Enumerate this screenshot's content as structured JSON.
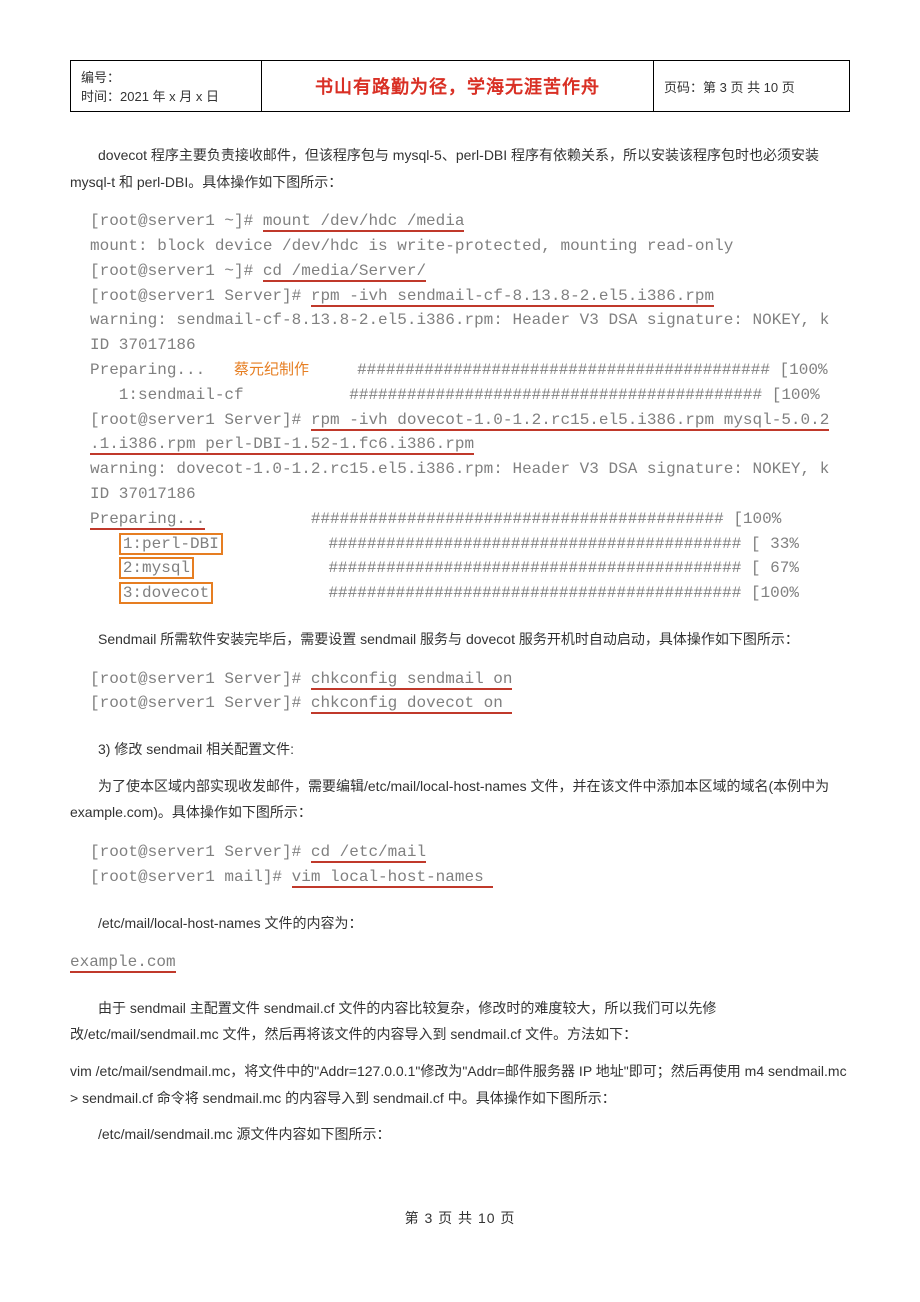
{
  "header": {
    "doc_id_label": "编号：",
    "date_line": "时间：2021 年 x 月 x 日",
    "motto": "书山有路勤为径，学海无涯苦作舟",
    "page_label": "页码：第 3 页 共 10 页"
  },
  "p1": "dovecot 程序主要负责接收邮件，但该程序包与 mysql-5、perl-DBI 程序有依赖关系，所以安装该程序包时也必须安装 mysql-t 和 perl-DBI。具体操作如下图所示：",
  "term1": {
    "l1_pre": "[root@server1 ~]# ",
    "l1_cmd": "mount /dev/hdc /media",
    "l2": "mount: block device /dev/hdc is write-protected, mounting read-only",
    "l3_pre": "[root@server1 ~]# ",
    "l3_cmd": "cd /media/Server/",
    "l4_pre": "[root@server1 Server]# ",
    "l4_cmd": "rpm -ivh sendmail-cf-8.13.8-2.el5.i386.rpm",
    "l5": "warning: sendmail-cf-8.13.8-2.el5.i386.rpm: Header V3 DSA signature: NOKEY, k",
    "l6": "ID 37017186",
    "l7a": "Preparing...",
    "wm": "蔡元纪制作",
    "hash_100": "########################################### [100%",
    "l8": "   1:sendmail-cf           ########################################### [100%",
    "l9_pre": "[root@server1 Server]# ",
    "l9_cmd": "rpm -ivh dovecot-1.0-1.2.rc15.el5.i386.rpm mysql-5.0.2",
    "l10_cmd": ".1.i386.rpm perl-DBI-1.52-1.fc6.i386.rpm",
    "l11": "warning: dovecot-1.0-1.2.rc15.el5.i386.rpm: Header V3 DSA signature: NOKEY, k",
    "l12": "ID 37017186",
    "l13": "Preparing...",
    "pkg1": "1:perl-DBI",
    "pkg1_tail": "           ########################################### [ 33%",
    "pkg2": "2:mysql",
    "pkg2_tail": "              ########################################### [ 67%",
    "pkg3": "3:dovecot",
    "pkg3_tail": "            ########################################### [100%"
  },
  "p2": "Sendmail 所需软件安装完毕后，需要设置 sendmail 服务与 dovecot 服务开机时自动启动，具体操作如下图所示：",
  "term2": {
    "l1_pre": "[root@server1 Server]# ",
    "l1_cmd": "chkconfig sendmail on",
    "l2_pre": "[root@server1 Server]# ",
    "l2_cmd": "chkconfig dovecot on "
  },
  "p3": "3) 修改 sendmail 相关配置文件:",
  "p4": "为了使本区域内部实现收发邮件，需要编辑/etc/mail/local-host-names 文件，并在该文件中添加本区域的域名(本例中为 example.com)。具体操作如下图所示：",
  "term3": {
    "l1_pre": "[root@server1 Server]# ",
    "l1_cmd": "cd /etc/mail",
    "l2_pre": "[root@server1 mail]# ",
    "l2_cmd": "vim local-host-names "
  },
  "p5": "/etc/mail/local-host-names 文件的内容为：",
  "term4": {
    "l1": "example.com"
  },
  "p6": "由于 sendmail 主配置文件 sendmail.cf 文件的内容比较复杂，修改时的难度较大，所以我们可以先修改/etc/mail/sendmail.mc 文件，然后再将该文件的内容导入到 sendmail.cf 文件。方法如下：",
  "p6b": "vim /etc/mail/sendmail.mc，将文件中的\"Addr=127.0.0.1\"修改为\"Addr=邮件服务器 IP 地址\"即可；然后再使用 m4 sendmail.mc > sendmail.cf 命令将 sendmail.mc 的内容导入到 sendmail.cf 中。具体操作如下图所示：",
  "p7": "/etc/mail/sendmail.mc 源文件内容如下图所示：",
  "footer": "第 3 页 共 10 页"
}
